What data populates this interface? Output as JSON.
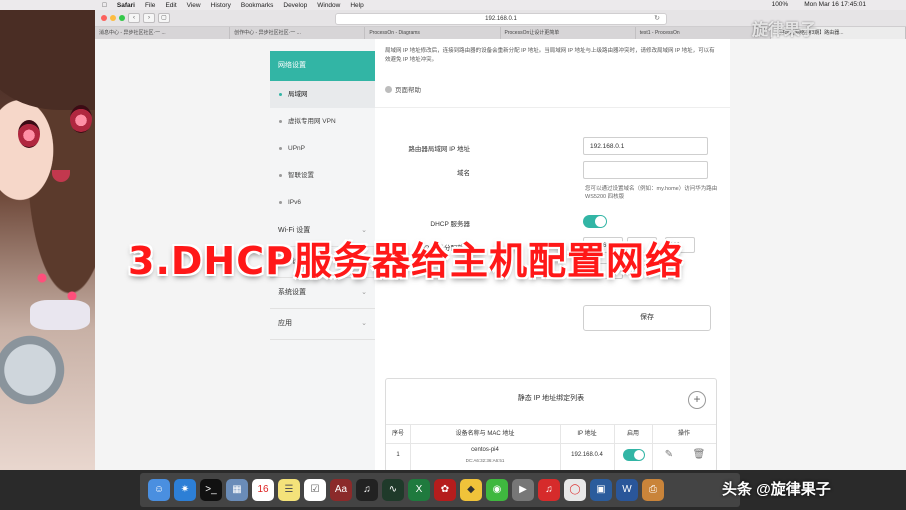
{
  "menubar": {
    "apple": "",
    "app": "Safari",
    "items": [
      "File",
      "Edit",
      "View",
      "History",
      "Bookmarks",
      "Develop",
      "Window",
      "Help"
    ],
    "battery": "100%",
    "clock": "Mon Mar 16  17:45:01"
  },
  "browser": {
    "url": "192.168.0.1",
    "tabs": [
      "消息中心 - 异步社区社区·一 ...",
      "创作中心 - 异步社区社区·一 ...",
      "ProcessOn - Diagrams",
      "ProcessOn让设计更简单",
      "test1 - ProcessOn",
      "【好玩的网络-第3期】路由器..."
    ]
  },
  "sidebar": {
    "sections": [
      {
        "label": "网络设置",
        "active": true
      },
      {
        "label": "Wi-Fi 设置",
        "active": false
      },
      {
        "label": "安全设置",
        "active": false
      },
      {
        "label": "系统设置",
        "active": false
      },
      {
        "label": "应用",
        "active": false
      }
    ],
    "subitems": [
      {
        "label": "局域网",
        "active": true
      },
      {
        "label": "虚拟专用网 VPN",
        "active": false
      },
      {
        "label": "UPnP",
        "active": false
      },
      {
        "label": "智联设置",
        "active": false
      },
      {
        "label": "IPv6",
        "active": false
      }
    ]
  },
  "main": {
    "note": "局域网 IP 地址修改后，连接到路由器的设备会重新分配 IP 地址。当局域网 IP 地址与上级路由器冲突时，请修改局域网 IP 地址，可以有效避免 IP 地址冲突。",
    "help_label": "页面帮助",
    "lan_ip_label": "路由器局域网 IP 地址",
    "lan_ip_value": "192.168.0.1",
    "domain_label": "域名",
    "domain_value": "",
    "domain_hint": "您可以通过设置域名（例如：my.home）访问华为路由WS5200 四核版",
    "dhcp_label": "DHCP 服务器",
    "dhcp_enabled": true,
    "ip_range_label": "IP 地址分配范围",
    "ip_range_start": "192.168.0",
    "ip_range_from": "100",
    "ip_range_to": "199",
    "lease_value": "1天",
    "save_label": "保存"
  },
  "static_table": {
    "title": "静态 IP 地址绑定列表",
    "add_icon": "plus-icon",
    "columns": [
      "序号",
      "设备名称与 MAC 地址",
      "IP 地址",
      "启用",
      "操作"
    ],
    "rows": [
      {
        "index": "1",
        "name": "centos-pi4",
        "mac": "DC:A6:32:36:A6:51",
        "ip": "192.168.0.4",
        "enabled": true
      }
    ]
  },
  "overlay_title": "3.DHCP服务器给主机配置网络",
  "watermarks": {
    "top": "旋律果子",
    "dock": "头条 @旋律果子"
  },
  "dock": {
    "icons": [
      "finder-icon",
      "safari-icon",
      "terminal-icon",
      "preview-icon",
      "calendar-icon",
      "notes-icon",
      "reminders-icon",
      "dictionary-icon",
      "piano-icon",
      "activity-icon",
      "excel-icon",
      "acrobat-icon",
      "sketch-icon",
      "wechat-icon",
      "iina-icon",
      "netease-music-icon",
      "chrome-icon",
      "virtualbox-icon",
      "word-icon",
      "printer-icon"
    ],
    "calendar_day": "16"
  },
  "colors": {
    "accent": "#32b5a5",
    "overlay_red": "#ff1818"
  }
}
